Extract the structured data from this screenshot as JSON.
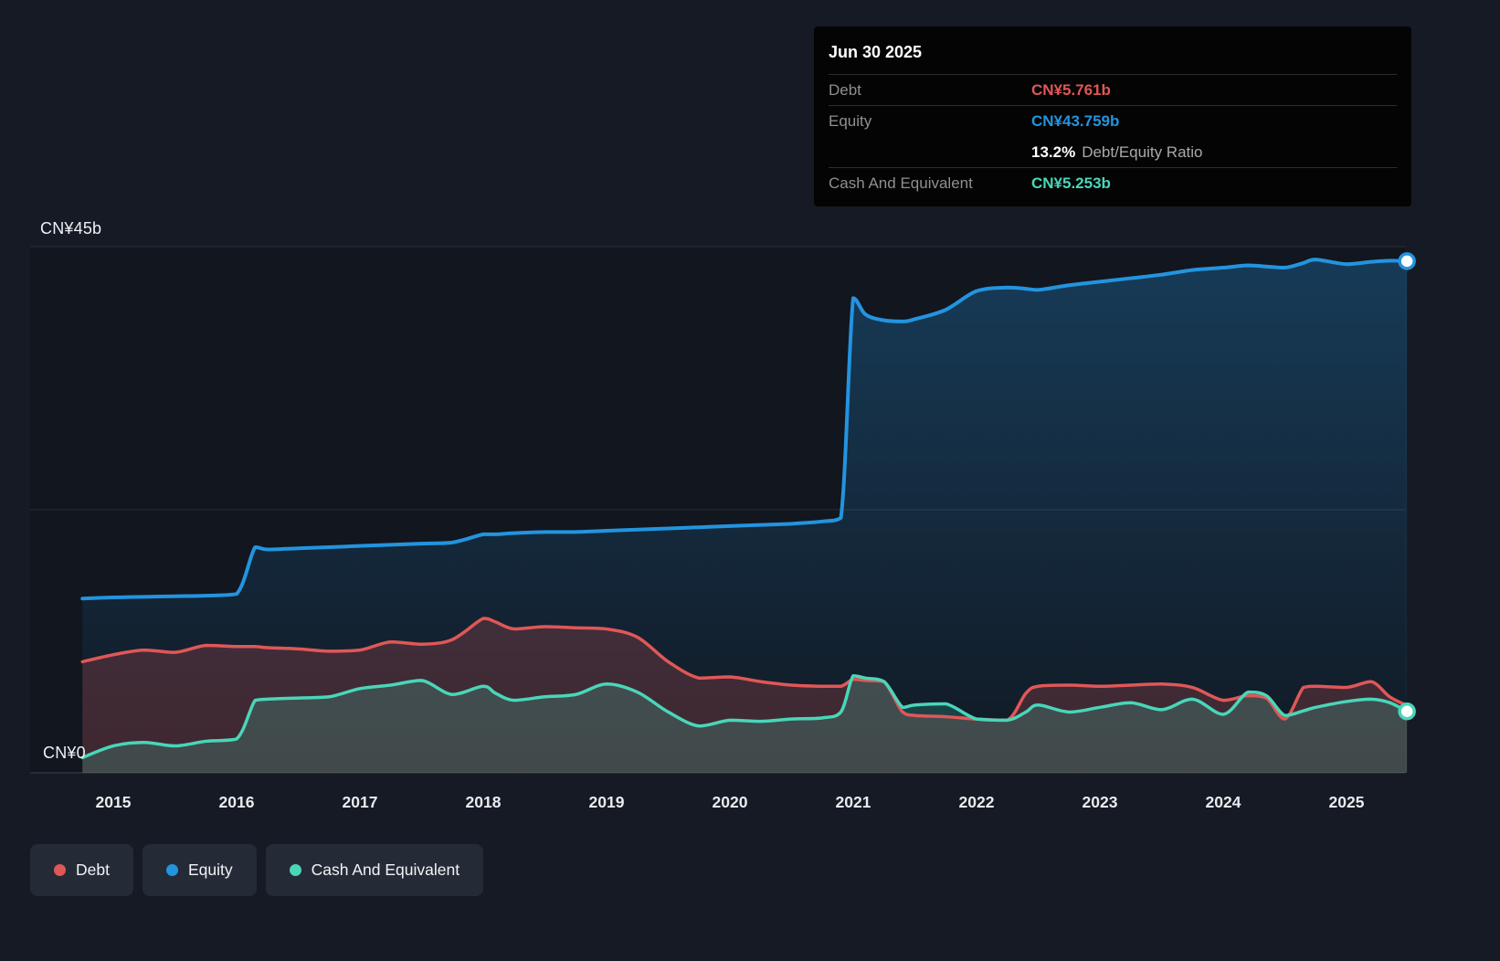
{
  "tooltip": {
    "date": "Jun 30 2025",
    "debt_label": "Debt",
    "debt_value": "CN¥5.761b",
    "equity_label": "Equity",
    "equity_value": "CN¥43.759b",
    "ratio_value": "13.2%",
    "ratio_label": "Debt/Equity Ratio",
    "cash_label": "Cash And Equivalent",
    "cash_value": "CN¥5.253b"
  },
  "legend": {
    "items": [
      {
        "label": "Debt",
        "color": "#e05757"
      },
      {
        "label": "Equity",
        "color": "#2394df"
      },
      {
        "label": "Cash And Equivalent",
        "color": "#49d6b9"
      }
    ]
  },
  "colors": {
    "background": "#151a24",
    "grid": "rgba(255,255,255,0.10)",
    "axis_text": "#e9ecef",
    "tooltip_background": "#040404"
  },
  "chart_data": {
    "type": "area",
    "title": "",
    "xlabel": "",
    "ylabel": "",
    "x_range": [
      2014.75,
      2025.49
    ],
    "x_ticks": [
      "2015",
      "2016",
      "2017",
      "2018",
      "2019",
      "2020",
      "2021",
      "2022",
      "2023",
      "2024",
      "2025"
    ],
    "y_axis": {
      "top_label": "CN¥45b",
      "bottom_label": "CN¥0",
      "ylim": [
        0,
        45
      ],
      "gridlines": [
        0,
        22.5,
        45
      ],
      "unit": "CN¥ billions"
    },
    "legend_position": "bottom-left",
    "x": [
      2014.75,
      2015.0,
      2015.25,
      2015.5,
      2015.75,
      2016.0,
      2016.15,
      2016.25,
      2016.5,
      2016.75,
      2017.0,
      2017.25,
      2017.5,
      2017.75,
      2018.0,
      2018.1,
      2018.25,
      2018.5,
      2018.75,
      2019.0,
      2019.25,
      2019.5,
      2019.75,
      2020.0,
      2020.25,
      2020.5,
      2020.75,
      2020.9,
      2021.0,
      2021.1,
      2021.25,
      2021.4,
      2021.5,
      2021.75,
      2022.0,
      2022.25,
      2022.4,
      2022.5,
      2022.75,
      2023.0,
      2023.25,
      2023.5,
      2023.75,
      2024.0,
      2024.2,
      2024.35,
      2024.5,
      2024.65,
      2024.75,
      2025.0,
      2025.2,
      2025.35,
      2025.49
    ],
    "series": [
      {
        "name": "Equity",
        "color": "#2394df",
        "line_width": 4,
        "fill_opacity_top": 0.3,
        "fill_opacity_bottom": 0.02,
        "end_marker": true,
        "end_value": "CN¥43.759b",
        "values": [
          14.9,
          15.0,
          15.05,
          15.1,
          15.15,
          15.3,
          19.3,
          19.1,
          19.2,
          19.3,
          19.4,
          19.5,
          19.6,
          19.7,
          20.4,
          20.4,
          20.5,
          20.6,
          20.6,
          20.7,
          20.8,
          20.9,
          21.0,
          21.1,
          21.2,
          21.3,
          21.5,
          21.8,
          40.6,
          39.2,
          38.7,
          38.6,
          38.8,
          39.6,
          41.2,
          41.5,
          41.4,
          41.3,
          41.7,
          42.0,
          42.3,
          42.6,
          43.0,
          43.2,
          43.4,
          43.3,
          43.2,
          43.6,
          43.9,
          43.5,
          43.7,
          43.8,
          43.759
        ]
      },
      {
        "name": "Debt",
        "color": "#e05757",
        "line_width": 3.5,
        "fill_opacity_top": 0.22,
        "fill_opacity_bottom": 0.22,
        "end_marker": false,
        "end_value": "CN¥5.761b",
        "values": [
          9.5,
          10.1,
          10.5,
          10.3,
          10.9,
          10.8,
          10.8,
          10.7,
          10.6,
          10.4,
          10.5,
          11.2,
          11.0,
          11.4,
          13.2,
          12.9,
          12.3,
          12.5,
          12.4,
          12.3,
          11.6,
          9.5,
          8.1,
          8.2,
          7.8,
          7.5,
          7.4,
          7.4,
          8.0,
          7.9,
          7.8,
          5.2,
          4.9,
          4.8,
          4.6,
          4.5,
          6.8,
          7.4,
          7.5,
          7.4,
          7.5,
          7.6,
          7.3,
          6.2,
          6.6,
          6.4,
          4.6,
          7.3,
          7.4,
          7.3,
          7.8,
          6.5,
          5.761
        ]
      },
      {
        "name": "Cash And Equivalent",
        "color": "#49d6b9",
        "line_width": 3.5,
        "fill_opacity_top": 0.2,
        "fill_opacity_bottom": 0.2,
        "end_marker": true,
        "end_value": "CN¥5.253b",
        "values": [
          1.3,
          2.3,
          2.6,
          2.3,
          2.7,
          2.9,
          6.2,
          6.3,
          6.4,
          6.5,
          7.2,
          7.5,
          7.9,
          6.7,
          7.4,
          6.8,
          6.2,
          6.5,
          6.7,
          7.6,
          6.9,
          5.2,
          4.0,
          4.5,
          4.4,
          4.6,
          4.7,
          5.2,
          8.3,
          8.1,
          7.8,
          5.6,
          5.8,
          5.9,
          4.6,
          4.5,
          5.2,
          5.8,
          5.2,
          5.6,
          6.0,
          5.4,
          6.3,
          5.0,
          6.9,
          6.6,
          4.9,
          5.3,
          5.6,
          6.1,
          6.3,
          6.0,
          5.253
        ]
      }
    ]
  }
}
